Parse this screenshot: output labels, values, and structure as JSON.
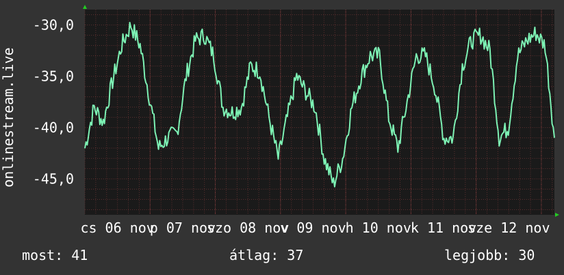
{
  "chart_data": {
    "type": "line",
    "ylabel": "onlinestream.live",
    "ylim": [
      -48.5,
      -28.5
    ],
    "y_ticks": [
      -30,
      -35,
      -40,
      -45
    ],
    "y_tick_labels": [
      "-30,0",
      "-35,0",
      "-40,0",
      "-45,0"
    ],
    "x_tick_labels": [
      "cs 06 nov",
      "p 07 nov",
      "szo 08 nov",
      "v 09 nov",
      "h 10 nov",
      "k 11 nov",
      "sze 12 nov"
    ],
    "grid": true,
    "colors": {
      "background": "#333333",
      "plot_background": "#1a1a1a",
      "line": "#7df2b4",
      "grid": "#5a2e2e",
      "axis_arrow": "#22cc22"
    },
    "series": [
      {
        "x_days": [
          0,
          0.2,
          0.4,
          0.6,
          0.8,
          1,
          1.2,
          1.4,
          1.6,
          1.8,
          2,
          2.2,
          2.4,
          2.6,
          2.8,
          3,
          3.2,
          3.4,
          3.6,
          3.8,
          4,
          4.2,
          4.4,
          4.6,
          4.8,
          5,
          5.2,
          5.4,
          5.6,
          5.8,
          6,
          6.2,
          6.4,
          6.6,
          6.8,
          7,
          7.2
        ],
        "values": [
          -42,
          -38,
          -39.5,
          -35.5,
          -32,
          -30,
          -32,
          -37,
          -42,
          -41,
          -40.5,
          -35,
          -31.5,
          -31,
          -33,
          -38,
          -38.5,
          -38,
          -34,
          -34.5,
          -39,
          -43,
          -39,
          -35,
          -36.5,
          -38,
          -43,
          -45.5,
          -43,
          -38,
          -35,
          -33,
          -33,
          -39,
          -42,
          -37.5,
          -33,
          -33,
          -36,
          -41,
          -41,
          -34,
          -31.5,
          -31,
          -32.5,
          -41,
          -40,
          -33,
          -31.5,
          -30.8,
          -32,
          -41
        ]
      }
    ],
    "readouts": {
      "current": "most: 41",
      "average": "átlag: 37",
      "best": "legjobb: 30"
    }
  }
}
